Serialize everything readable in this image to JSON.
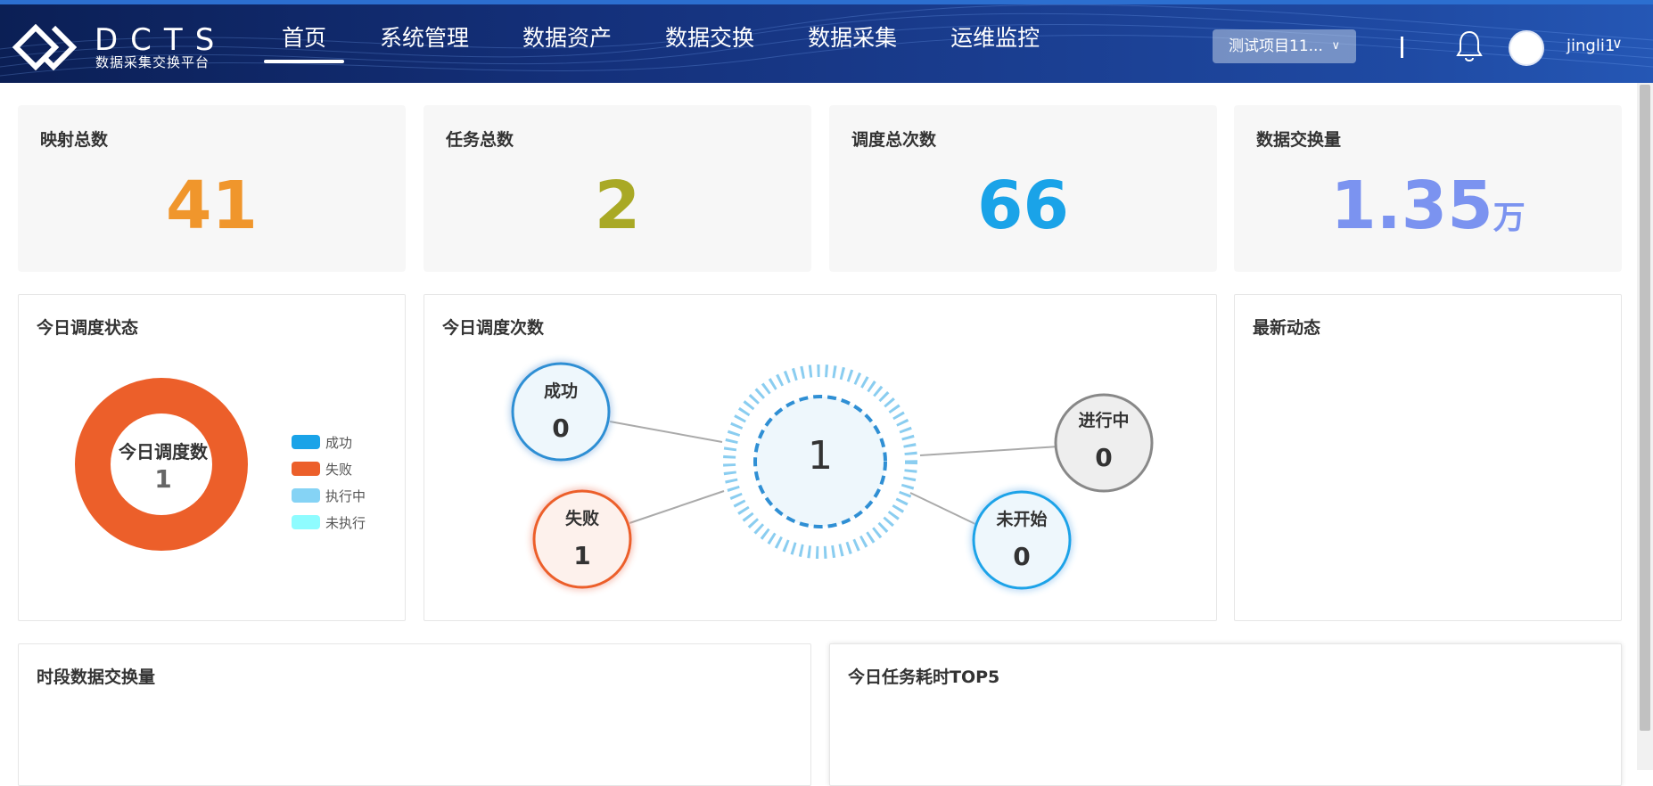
{
  "header": {
    "logo_title": "DCTS",
    "logo_subtitle": "数据采集交换平台",
    "nav": [
      {
        "label": "首页",
        "active": true
      },
      {
        "label": "系统管理",
        "active": false
      },
      {
        "label": "数据资产",
        "active": false
      },
      {
        "label": "数据交换",
        "active": false
      },
      {
        "label": "数据采集",
        "active": false
      },
      {
        "label": "运维监控",
        "active": false
      }
    ],
    "project": "测试项目11...",
    "username": "jingli1"
  },
  "stats": [
    {
      "label": "映射总数",
      "value": "41",
      "unit": "",
      "color": "#f0962c"
    },
    {
      "label": "任务总数",
      "value": "2",
      "unit": "",
      "color": "#a9a925"
    },
    {
      "label": "调度总次数",
      "value": "66",
      "unit": "",
      "color": "#1aa3e8"
    },
    {
      "label": "数据交换量",
      "value": "1.35",
      "unit": "万",
      "color": "#7b93f0"
    }
  ],
  "today_status": {
    "title": "今日调度状态",
    "center_label": "今日调度数",
    "center_value": "1",
    "legend": [
      {
        "label": "成功",
        "color": "#1aa3e8"
      },
      {
        "label": "失败",
        "color": "#ec5f2a"
      },
      {
        "label": "执行中",
        "color": "#85d3f5"
      },
      {
        "label": "未执行",
        "color": "#8efcff"
      }
    ]
  },
  "today_count": {
    "title": "今日调度次数",
    "center_value": "1",
    "nodes": [
      {
        "label": "成功",
        "value": "0"
      },
      {
        "label": "失败",
        "value": "1"
      },
      {
        "label": "进行中",
        "value": "0"
      },
      {
        "label": "未开始",
        "value": "0"
      }
    ]
  },
  "latest": {
    "title": "最新动态"
  },
  "period_volume": {
    "title": "时段数据交换量"
  },
  "top5": {
    "title": "今日任务耗时TOP5"
  },
  "chart_data": {
    "type": "pie",
    "title": "今日调度状态",
    "categories": [
      "成功",
      "失败",
      "执行中",
      "未执行"
    ],
    "values": [
      0,
      1,
      0,
      0
    ]
  }
}
